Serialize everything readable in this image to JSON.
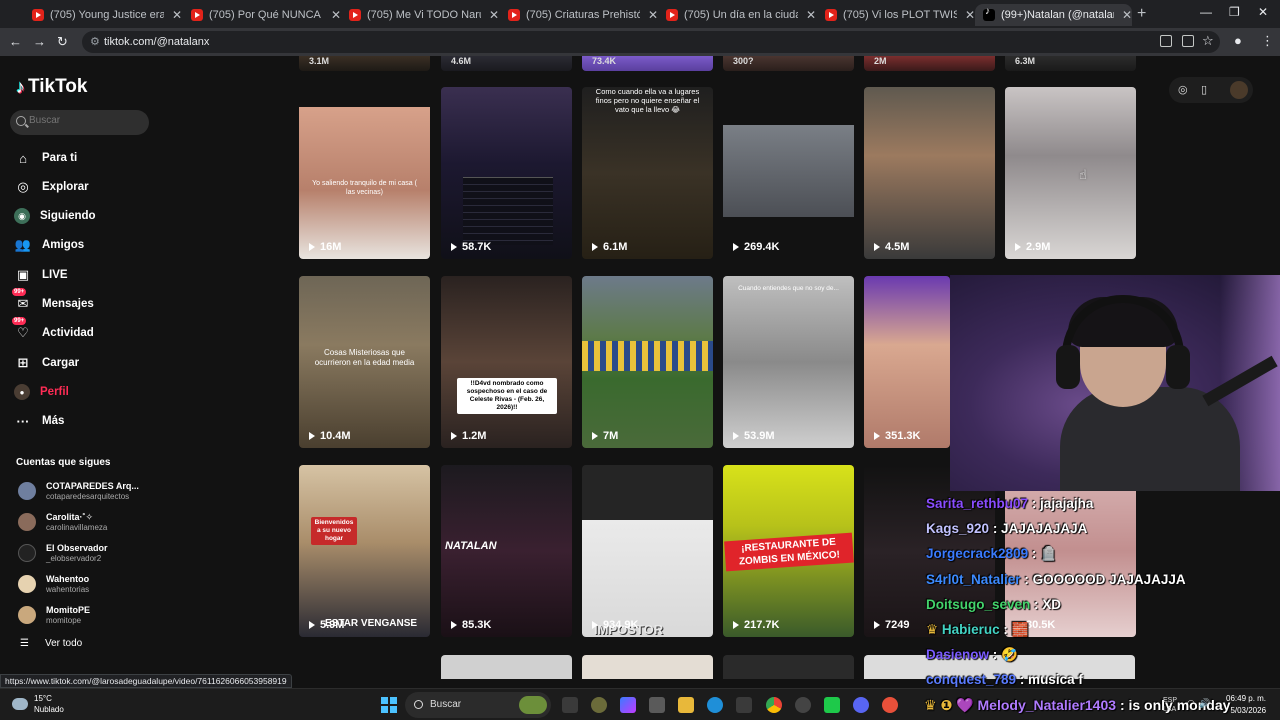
{
  "browser": {
    "tabs": [
      {
        "title": "(705) Young Justice era la serie"
      },
      {
        "title": "(705) Por Qué NUNCA Debes M"
      },
      {
        "title": "(705) Me Vi TODO Naruto y no"
      },
      {
        "title": "(705) Criaturas Prehistóricas Q"
      },
      {
        "title": "(705) Un día en la ciudad más C"
      },
      {
        "title": "(705) Vi los PLOT TWIST más Bl"
      },
      {
        "title": "(99+)Natalan (@natalanx) | TikT"
      }
    ],
    "url": "tiktok.com/@natalanx",
    "status_url": "https://www.tiktok.com/@larosadeguadalupe/video/7611626066053958919"
  },
  "sidebar": {
    "logo": "TikTok",
    "search_placeholder": "Buscar",
    "nav": [
      {
        "label": "Para ti",
        "icon": "home-icon"
      },
      {
        "label": "Explorar",
        "icon": "compass-icon"
      },
      {
        "label": "Siguiendo",
        "icon": "following-icon"
      },
      {
        "label": "Amigos",
        "icon": "friends-icon"
      },
      {
        "label": "LIVE",
        "icon": "live-icon"
      },
      {
        "label": "Mensajes",
        "icon": "messages-icon",
        "badge": "99+"
      },
      {
        "label": "Actividad",
        "icon": "activity-icon",
        "badge": "99+"
      },
      {
        "label": "Cargar",
        "icon": "upload-icon"
      },
      {
        "label": "Perfil",
        "icon": "profile-icon"
      },
      {
        "label": "Más",
        "icon": "more-icon"
      }
    ],
    "following_header": "Cuentas que sigues",
    "accounts": [
      {
        "name": "COTAPAREDES Arq...",
        "handle": "cotaparedesarquitectos"
      },
      {
        "name": "Carolita·˚✧",
        "handle": "carolinavillameza"
      },
      {
        "name": "El Observador",
        "handle": "_elobservador2"
      },
      {
        "name": "Wahentoo",
        "handle": "wahentorias"
      },
      {
        "name": "MomitoPE",
        "handle": "momitope"
      }
    ],
    "see_all": "Ver todo"
  },
  "grid": {
    "top_partial": [
      "3.1M",
      "4.6M",
      "73.4K",
      "300?",
      "2M",
      "6.3M"
    ],
    "row1": [
      {
        "views": "16M",
        "caption": "Yo saliendo tranquilo de mi casa ( las vecinas)"
      },
      {
        "views": "58.7K",
        "caption": ""
      },
      {
        "views": "6.1M",
        "caption": "Como cuando ella va a lugares finos pero no quiere enseñar el vato que la llevo 😂"
      },
      {
        "views": "269.4K",
        "caption": ""
      },
      {
        "views": "4.5M",
        "caption": ""
      },
      {
        "views": "2.9M",
        "caption": ""
      }
    ],
    "row2": [
      {
        "views": "10.4M",
        "caption": "Cosas Misteriosas que ocurrieron en la edad media"
      },
      {
        "views": "1.2M",
        "caption": "!!D4vd nombrado como sospechoso en el caso de Celeste Rivas - (Feb. 26, 2026)!!"
      },
      {
        "views": "7M",
        "caption": ""
      },
      {
        "views": "53.9M",
        "caption": "Cuando entiendes que no soy de..."
      },
      {
        "views": "351.3K",
        "caption": ""
      }
    ],
    "row3": [
      {
        "views": "5.9M",
        "caption": "Bienvenidos a su nuevo hogar",
        "overlay": "ESTAR VENGANSE"
      },
      {
        "views": "85.3K",
        "caption": "NATALAN"
      },
      {
        "views": "934.9K",
        "caption": "IMPOSTOR"
      },
      {
        "views": "217.7K",
        "caption": "¡RESTAURANTE DE ZOMBIS EN MÉXICO!"
      },
      {
        "views": "7249",
        "caption": ""
      },
      {
        "views": "30.5K",
        "caption": ""
      }
    ]
  },
  "chat": [
    {
      "user": "Sarita_rethbu07",
      "color": "#8a4dff",
      "msg": ": jajajajha"
    },
    {
      "user": "Kags_920",
      "color": "#c2c2ff",
      "msg": ": JAJAJAJAJA"
    },
    {
      "user": "Jorgecrack2809",
      "color": "#3a7bff",
      "msg": ": 🪦"
    },
    {
      "user": "S4rl0t_Natalier",
      "color": "#3d8bff",
      "msg": ": GOOOOOD JAJAJAJJA"
    },
    {
      "user": "Doitsugo_seven",
      "color": "#43d36b",
      "msg": ": XD"
    },
    {
      "user": "Habieruc",
      "color": "#43d3c4",
      "msg": ": 🧱"
    },
    {
      "user": "Dasienow",
      "color": "#7a5bff",
      "msg": ": 🤣"
    },
    {
      "user": "conquest_789",
      "color": "#5b7cff",
      "msg": ": musica f"
    },
    {
      "user": "Melody_Natalier1403",
      "color": "#b07bff",
      "msg": ": is only monday"
    }
  ],
  "taskbar": {
    "temp": "15°C",
    "weather": "Nublado",
    "search": "Buscar",
    "lang": "ESP",
    "lang2": "LAA",
    "time": "06:49 p. m.",
    "date": "5/03/2026"
  },
  "colors": {
    "accent": "#fe2c55",
    "bg": "#121212"
  }
}
